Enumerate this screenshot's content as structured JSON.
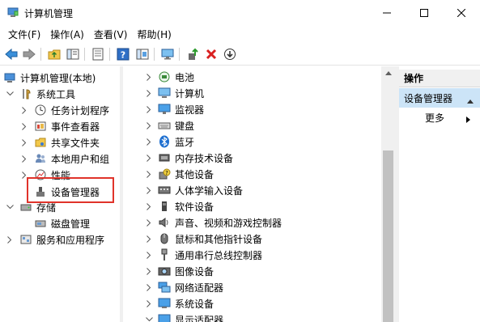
{
  "window": {
    "title": "计算机管理",
    "minimize_glyph": "—",
    "maximize_glyph": "☐",
    "close_glyph": "✕"
  },
  "menu": [
    "文件(F)",
    "操作(A)",
    "查看(V)",
    "帮助(H)"
  ],
  "toolbar_icons": [
    "back-icon",
    "forward-icon",
    "up-folder-icon",
    "show-hide-tree-icon",
    "properties-icon",
    "help-icon",
    "help-topics-icon",
    "monitor-icon",
    "update-driver-icon",
    "uninstall-icon",
    "download-icon"
  ],
  "tree": {
    "root": "计算机管理(本地)",
    "system_tools": "系统工具",
    "task_scheduler": "任务计划程序",
    "event_viewer": "事件查看器",
    "shared_folders": "共享文件夹",
    "local_users": "本地用户和组",
    "performance": "性能",
    "device_manager": "设备管理器",
    "storage": "存储",
    "disk_management": "磁盘管理",
    "services_apps": "服务和应用程序"
  },
  "devices": [
    {
      "label": "电池",
      "icon": "battery-icon"
    },
    {
      "label": "计算机",
      "icon": "computer-icon"
    },
    {
      "label": "监视器",
      "icon": "monitor-icon"
    },
    {
      "label": "键盘",
      "icon": "keyboard-icon"
    },
    {
      "label": "蓝牙",
      "icon": "bluetooth-icon"
    },
    {
      "label": "内存技术设备",
      "icon": "memory-icon"
    },
    {
      "label": "其他设备",
      "icon": "unknown-device-icon"
    },
    {
      "label": "人体学输入设备",
      "icon": "hid-icon"
    },
    {
      "label": "软件设备",
      "icon": "software-device-icon"
    },
    {
      "label": "声音、视频和游戏控制器",
      "icon": "speaker-icon"
    },
    {
      "label": "鼠标和其他指针设备",
      "icon": "mouse-icon"
    },
    {
      "label": "通用串行总线控制器",
      "icon": "usb-icon"
    },
    {
      "label": "图像设备",
      "icon": "camera-icon"
    },
    {
      "label": "网络适配器",
      "icon": "network-icon"
    },
    {
      "label": "系统设备",
      "icon": "system-device-icon"
    },
    {
      "label": "显示适配器",
      "icon": "display-adapter-icon"
    }
  ],
  "actions": {
    "header": "操作",
    "selected": "设备管理器",
    "more": "更多"
  },
  "colors": {
    "selection": "#cce4f7",
    "highlight_box": "#e0332a",
    "pane_bg": "#f0f0f0"
  }
}
